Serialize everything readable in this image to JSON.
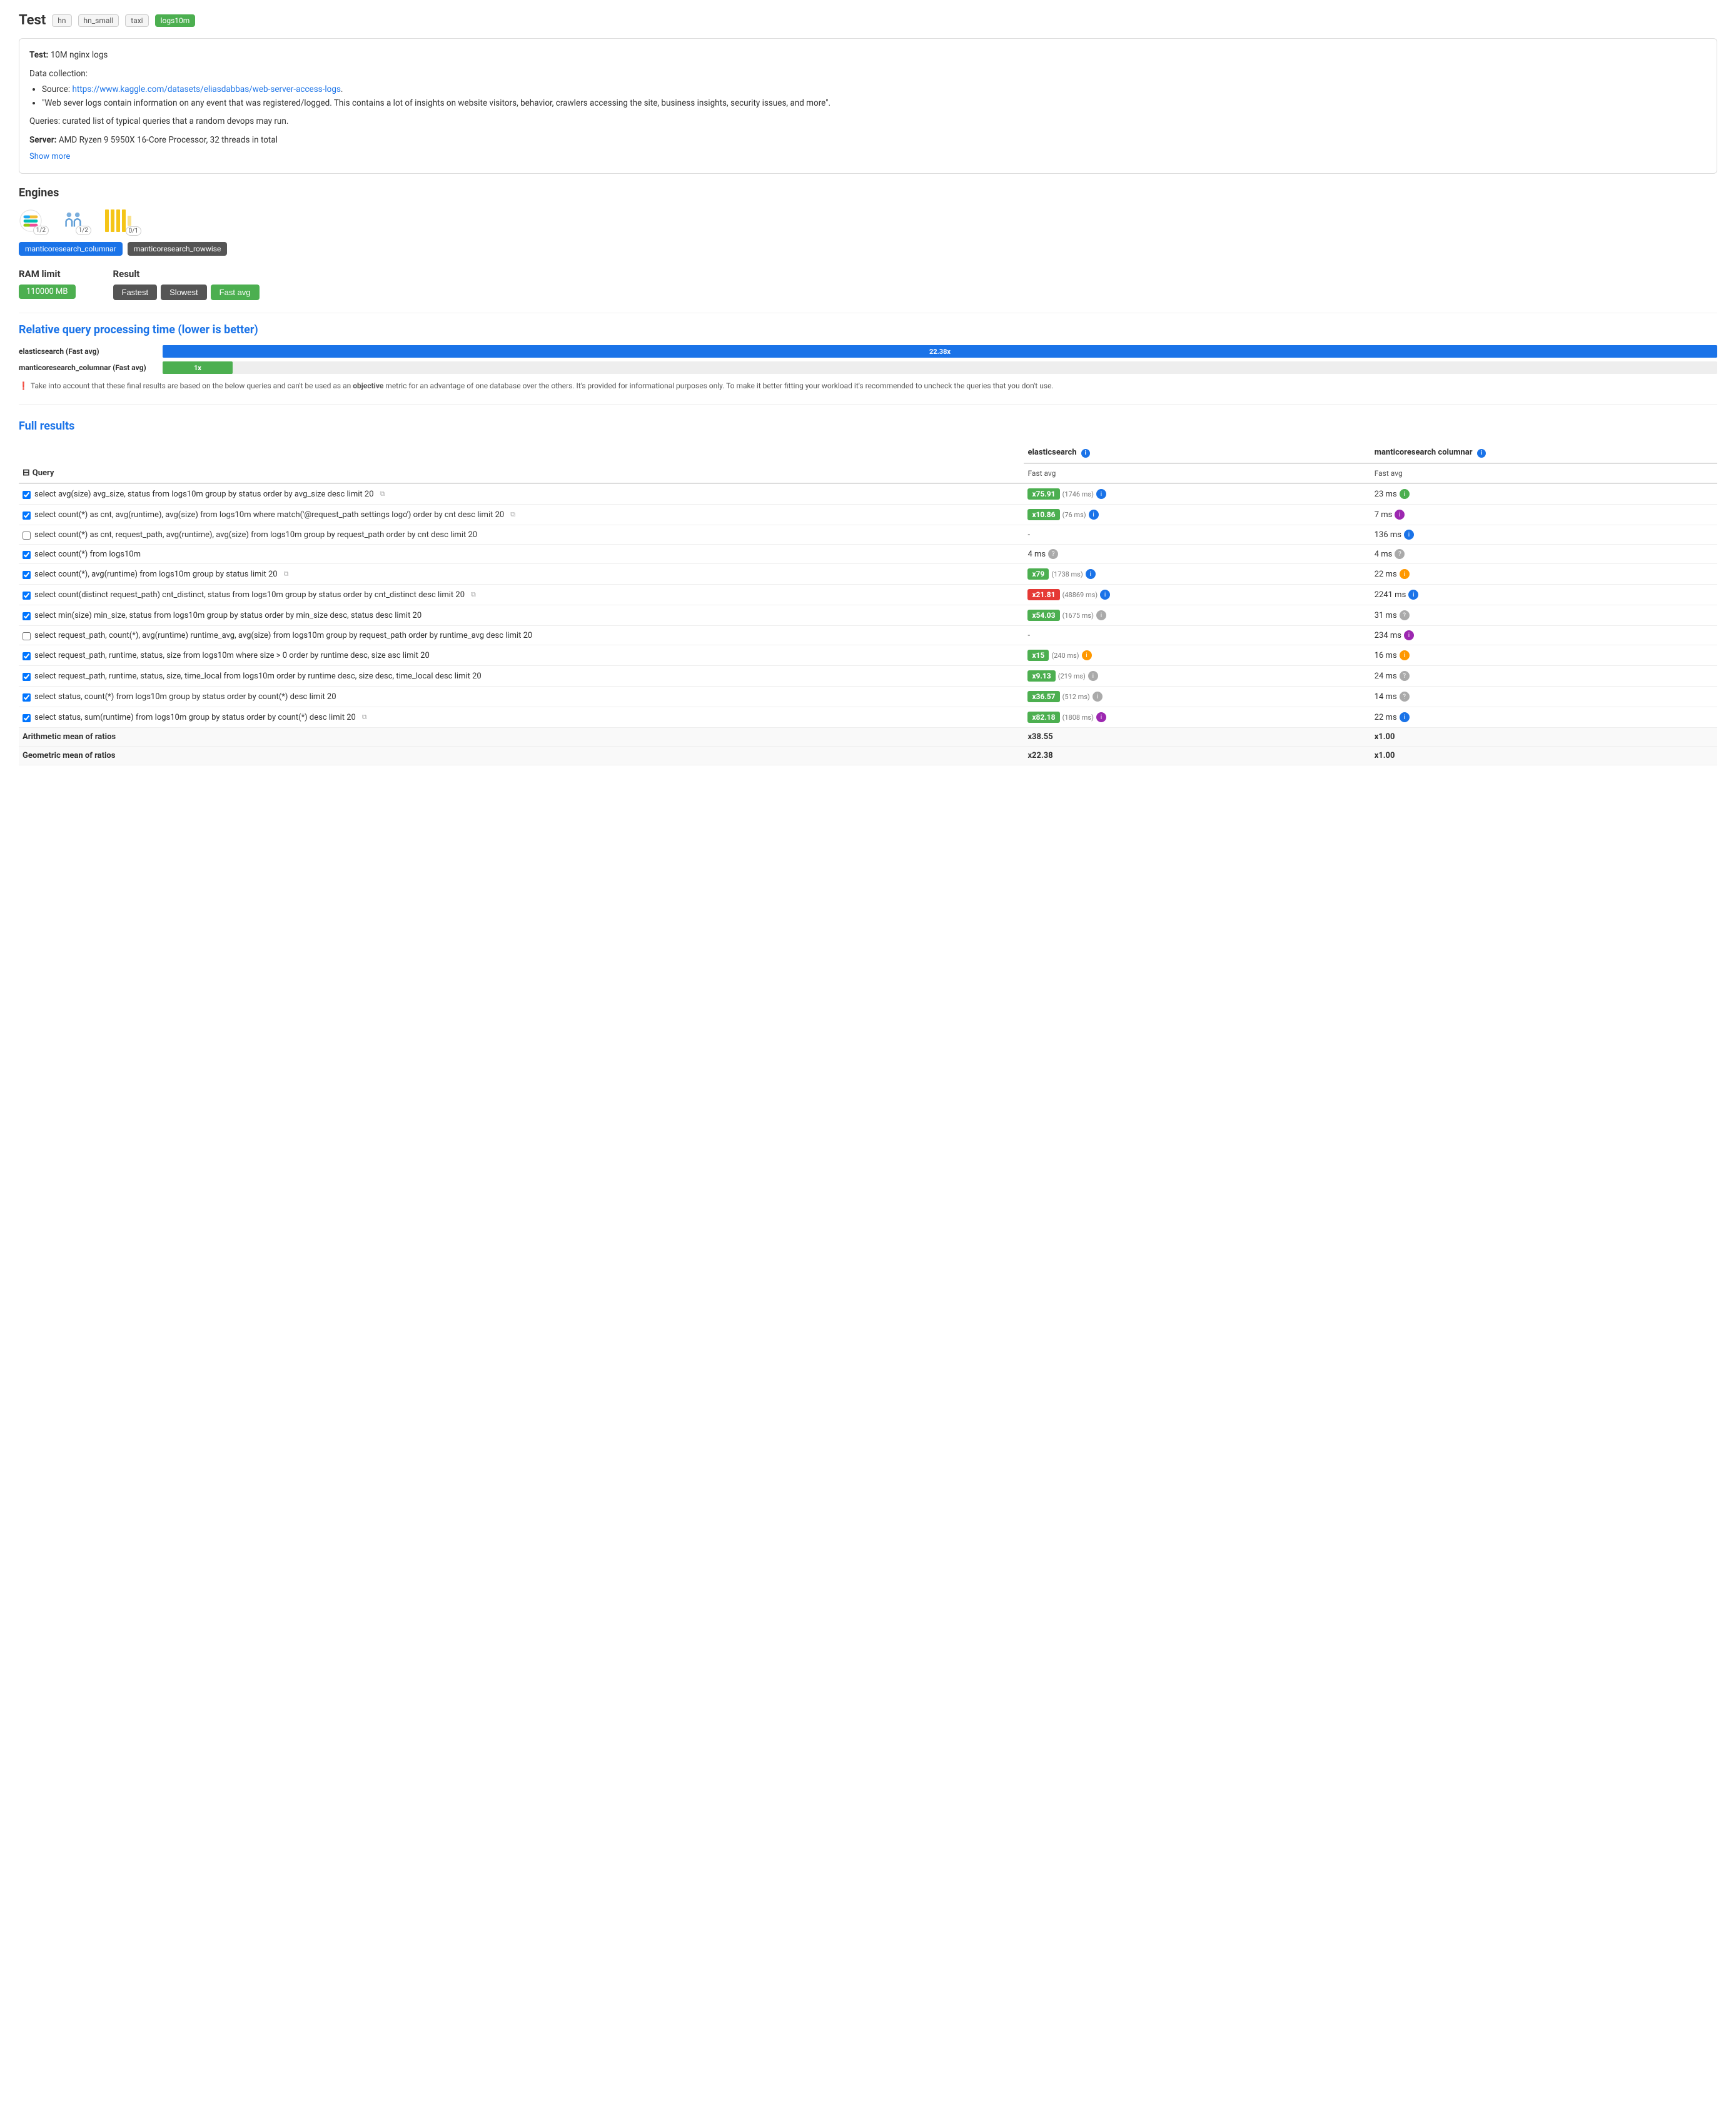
{
  "header": {
    "title": "Test",
    "tags": [
      {
        "label": "hn",
        "active": false
      },
      {
        "label": "hn_small",
        "active": false
      },
      {
        "label": "taxi",
        "active": false
      },
      {
        "label": "logs10m",
        "active": true
      }
    ]
  },
  "info_box": {
    "test_label": "Test:",
    "test_value": "10M nginx logs",
    "data_collection_label": "Data collection:",
    "source_prefix": "Source: ",
    "source_url": "https://www.kaggle.com/datasets/eliasdabbas/web-server-access-logs",
    "source_url_text": "https://www.kaggle.com/datasets/eliasdabbas/web-server-access-logs",
    "source_note": "\"Web sever logs contain information on any event that was registered/logged. This contains a lot of insights on website visitors, behavior, crawlers accessing the site, business insights, security issues, and more\".",
    "queries_text": "Queries: curated list of typical queries that a random devops may run.",
    "server_label": "Server:",
    "server_value": "AMD Ryzen 9 5950X 16-Core Processor, 32 threads in total",
    "show_more": "Show more"
  },
  "engines_section": {
    "title": "Engines",
    "engines": [
      {
        "name": "elasticsearch",
        "badge": "1/2"
      },
      {
        "name": "manticore",
        "badge": "1/2"
      },
      {
        "name": "clickhouse",
        "badge": "0/1"
      }
    ],
    "selected_tags": [
      "manticoresearch_columnar",
      "manticoresearch_rowwise"
    ]
  },
  "ram_result": {
    "ram_label": "RAM limit",
    "ram_value": "110000 MB",
    "result_label": "Result",
    "result_buttons": [
      {
        "label": "Fastest",
        "active": false
      },
      {
        "label": "Slowest",
        "active": false
      },
      {
        "label": "Fast avg",
        "active": true
      }
    ]
  },
  "chart": {
    "title": "Relative query processing time (lower is better)",
    "bars": [
      {
        "label": "elasticsearch (Fast avg)",
        "value": 22.38,
        "max": 22.38,
        "text": "22.38x",
        "color": "blue"
      },
      {
        "label": "manticoresearch_columnar (Fast avg)",
        "value": 1,
        "max": 22.38,
        "text": "1x",
        "color": "green"
      }
    ],
    "warning": "Take into account that these final results are based on the below queries and can't be used as an objective metric for an advantage of one database over the others. It's provided for informational purposes only. To make it better fitting your workload it's recommended to uncheck the queries that you don't use."
  },
  "full_results": {
    "title": "Full results",
    "col_query": "Query",
    "col_elastic": "elasticsearch",
    "col_elastic_sub": "Fast avg",
    "col_manticore": "manticoresearch columnar",
    "col_manticore_sub": "Fast avg",
    "rows": [
      {
        "checked": true,
        "query": "select avg(size) avg_size, status from logs10m group by status order by avg_size desc limit 20",
        "has_icon": true,
        "elastic_val": "x75.91",
        "elastic_ms": "(1746 ms)",
        "elastic_badge": "green",
        "elastic_info": "blue",
        "manticore_val": "23 ms",
        "manticore_badge": "plain",
        "manticore_info": "green"
      },
      {
        "checked": true,
        "query": "select count(*) as cnt, avg(runtime), avg(size) from logs10m where match('@request_path settings logo') order by cnt desc limit 20",
        "has_icon": true,
        "elastic_val": "x10.86",
        "elastic_ms": "(76 ms)",
        "elastic_badge": "green",
        "elastic_info": "blue",
        "manticore_val": "7 ms",
        "manticore_badge": "plain",
        "manticore_info": "purple"
      },
      {
        "checked": false,
        "query": "select count(*) as cnt, request_path, avg(runtime), avg(size) from logs10m group by request_path order by cnt desc limit 20",
        "has_icon": false,
        "elastic_val": "-",
        "elastic_ms": "",
        "elastic_badge": "plain",
        "elastic_info": null,
        "manticore_val": "136 ms",
        "manticore_badge": "plain",
        "manticore_info": "blue"
      },
      {
        "checked": true,
        "query": "select count(*) from logs10m",
        "has_icon": false,
        "elastic_val": "4 ms",
        "elastic_ms": "",
        "elastic_badge": "plain",
        "elastic_info": "question",
        "manticore_val": "4 ms",
        "manticore_badge": "plain",
        "manticore_info": "question"
      },
      {
        "checked": true,
        "query": "select count(*), avg(runtime) from logs10m group by status limit 20",
        "has_icon": true,
        "elastic_val": "x79",
        "elastic_ms": "(1738 ms)",
        "elastic_badge": "green",
        "elastic_info": "blue",
        "manticore_val": "22 ms",
        "manticore_badge": "plain",
        "manticore_info": "orange"
      },
      {
        "checked": true,
        "query": "select count(distinct request_path) cnt_distinct, status from logs10m group by status order by cnt_distinct desc limit 20",
        "has_icon": true,
        "elastic_val": "x21.81",
        "elastic_ms": "(48869 ms)",
        "elastic_badge": "red",
        "elastic_info": "blue",
        "manticore_val": "2241 ms",
        "manticore_badge": "plain",
        "manticore_info": "blue"
      },
      {
        "checked": true,
        "query": "select min(size) min_size, status from logs10m group by status order by min_size desc, status desc limit 20",
        "has_icon": false,
        "elastic_val": "x54.03",
        "elastic_ms": "(1675 ms)",
        "elastic_badge": "green",
        "elastic_info": "question",
        "manticore_val": "31 ms",
        "manticore_badge": "plain",
        "manticore_info": "question"
      },
      {
        "checked": false,
        "query": "select request_path, count(*), avg(runtime) runtime_avg, avg(size) from logs10m group by request_path order by runtime_avg desc limit 20",
        "has_icon": false,
        "elastic_val": "-",
        "elastic_ms": "",
        "elastic_badge": "plain",
        "elastic_info": null,
        "manticore_val": "234 ms",
        "manticore_badge": "plain",
        "manticore_info": "purple"
      },
      {
        "checked": true,
        "query": "select request_path, runtime, status, size from logs10m where size > 0 order by runtime desc, size asc limit 20",
        "has_icon": false,
        "elastic_val": "x15",
        "elastic_ms": "(240 ms)",
        "elastic_badge": "green",
        "elastic_info": "orange",
        "manticore_val": "16 ms",
        "manticore_badge": "plain",
        "manticore_info": "orange"
      },
      {
        "checked": true,
        "query": "select request_path, runtime, status, size, time_local from logs10m order by runtime desc, size desc, time_local desc limit 20",
        "has_icon": false,
        "elastic_val": "x9.13",
        "elastic_ms": "(219 ms)",
        "elastic_badge": "green",
        "elastic_info": "question",
        "manticore_val": "24 ms",
        "manticore_badge": "plain",
        "manticore_info": "question"
      },
      {
        "checked": true,
        "query": "select status, count(*) from logs10m group by status order by count(*) desc limit 20",
        "has_icon": false,
        "elastic_val": "x36.57",
        "elastic_ms": "(512 ms)",
        "elastic_badge": "green",
        "elastic_info": "question",
        "manticore_val": "14 ms",
        "manticore_badge": "plain",
        "manticore_info": "question"
      },
      {
        "checked": true,
        "query": "select status, sum(runtime) from logs10m group by status order by count(*) desc limit 20",
        "has_icon": true,
        "elastic_val": "x82.18",
        "elastic_ms": "(1808 ms)",
        "elastic_badge": "green",
        "elastic_info": "purple",
        "manticore_val": "22 ms",
        "manticore_badge": "plain",
        "manticore_info": "blue"
      }
    ],
    "footer": [
      {
        "label": "Arithmetic mean of ratios",
        "elastic": "x38.55",
        "manticore": "x1.00"
      },
      {
        "label": "Geometric mean of ratios",
        "elastic": "x22.38",
        "manticore": "x1.00"
      }
    ]
  },
  "colors": {
    "blue": "#1a73e8",
    "green": "#4caf50",
    "red": "#e53935",
    "purple": "#9c27b0",
    "orange": "#ff9800",
    "gray": "#aaa"
  }
}
